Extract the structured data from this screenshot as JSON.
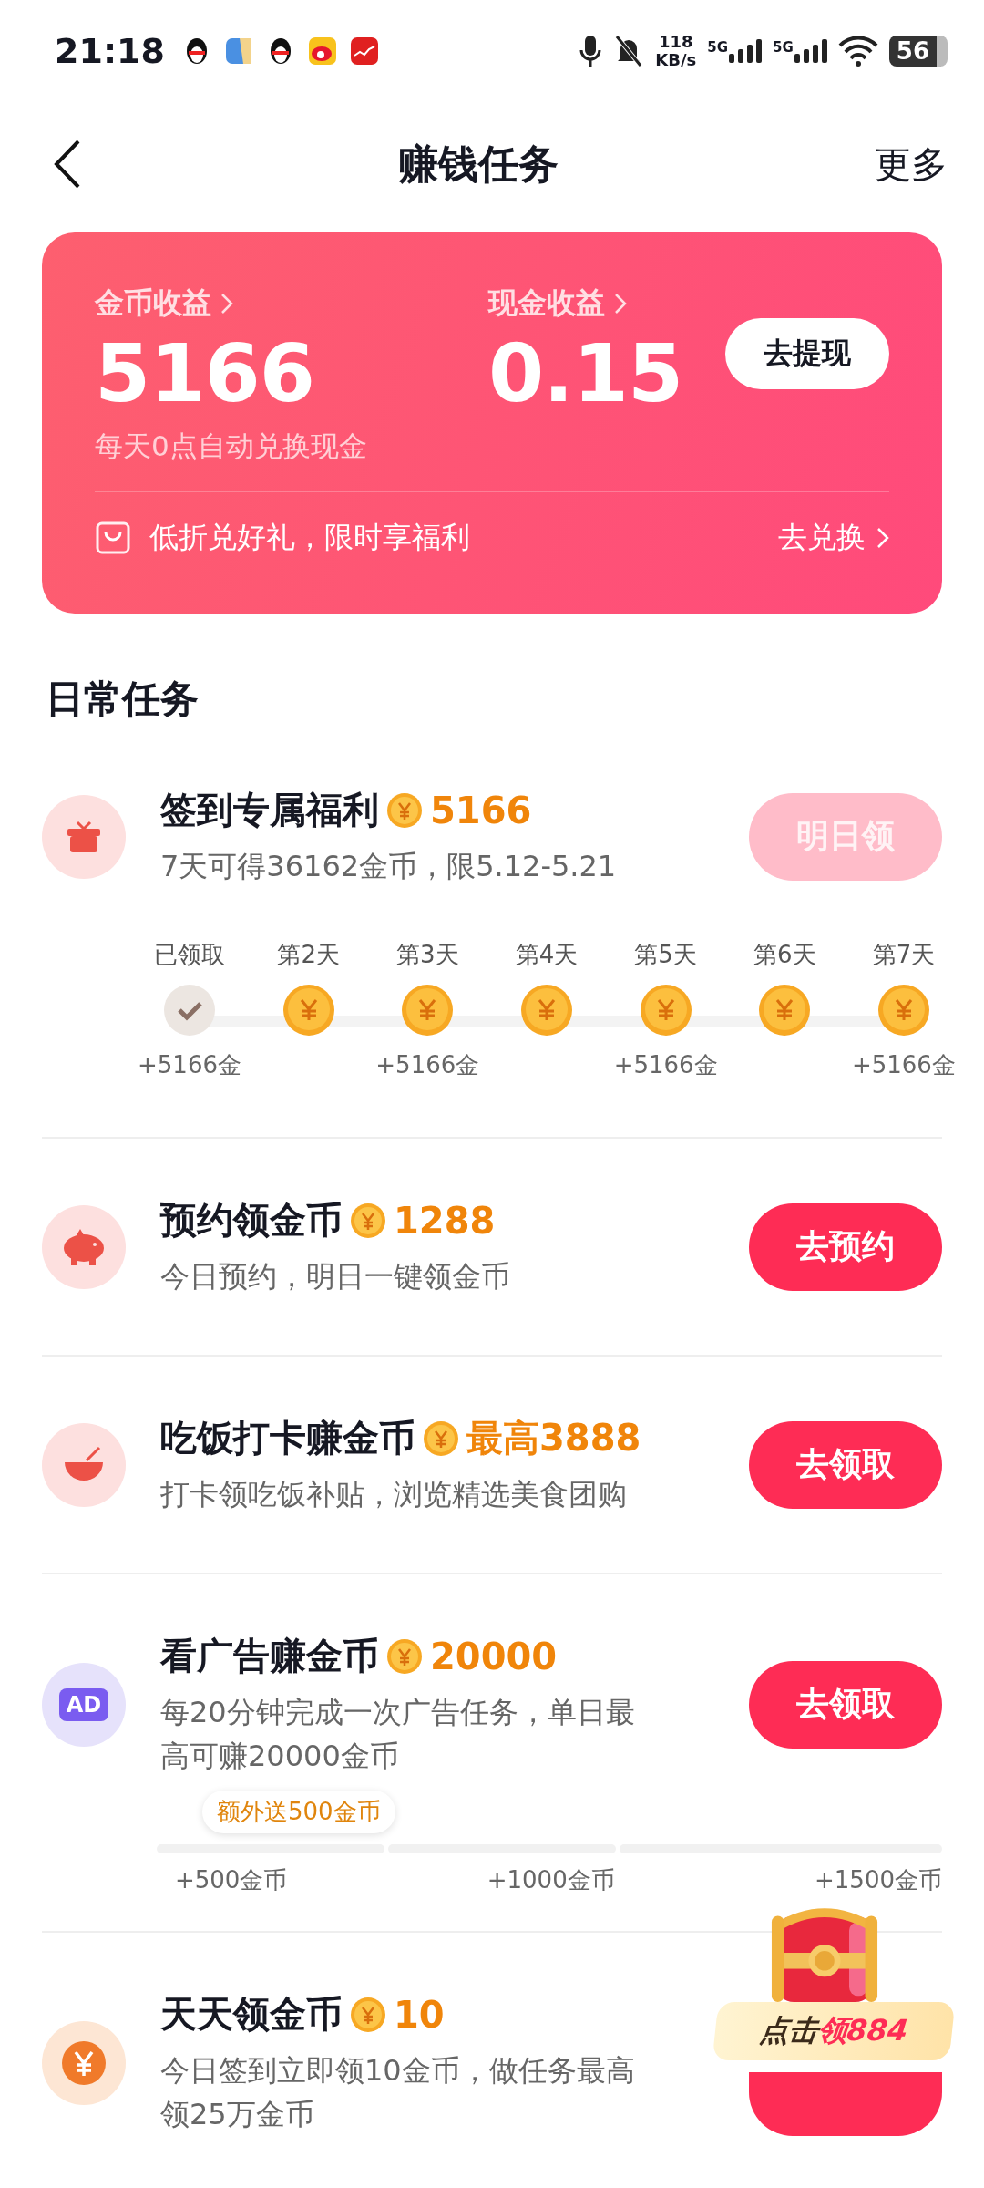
{
  "status_bar": {
    "time": "21:18",
    "net_speed_value": "118",
    "net_speed_unit": "KB/s",
    "sim1": "5G",
    "sim2": "5G",
    "battery": "56"
  },
  "nav": {
    "title": "赚钱任务",
    "more": "更多"
  },
  "earnings": {
    "coin_label": "金币收益",
    "coin_value": "5166",
    "cash_label": "现金收益",
    "cash_value": "0.15",
    "withdraw": "去提现",
    "note": "每天0点自动兑换现金",
    "promo": "低折兑好礼，限时享福利",
    "promo_link": "去兑换"
  },
  "section_title": "日常任务",
  "tasks": [
    {
      "kind": "checkin",
      "title": "签到专属福利",
      "reward": "5166",
      "desc": "7天可得36162金币，限5.12-5.21",
      "button": "明日领",
      "disabled": true,
      "steps": [
        {
          "label": "已领取",
          "claimed": true,
          "bonus": "+5166金"
        },
        {
          "label": "第2天",
          "claimed": false
        },
        {
          "label": "第3天",
          "claimed": false,
          "bonus": "+5166金"
        },
        {
          "label": "第4天",
          "claimed": false
        },
        {
          "label": "第5天",
          "claimed": false,
          "bonus": "+5166金"
        },
        {
          "label": "第6天",
          "claimed": false
        },
        {
          "label": "第7天",
          "claimed": false,
          "bonus": "+5166金"
        }
      ]
    },
    {
      "kind": "plain",
      "title": "预约领金币",
      "reward": "1288",
      "desc": "今日预约，明日一键领金币",
      "button": "去预约",
      "disabled": false
    },
    {
      "kind": "plain",
      "title": "吃饭打卡赚金币",
      "reward": "最高3888",
      "desc": "打卡领吃饭补贴，浏览精选美食团购",
      "button": "去领取",
      "disabled": false
    },
    {
      "kind": "ad",
      "icon_text": "AD",
      "title": "看广告赚金币",
      "reward": "20000",
      "desc": "每20分钟完成一次广告任务，单日最高可赚20000金币",
      "button": "去领取",
      "disabled": false,
      "tooltip": "额外送500金币",
      "milestones": [
        "+500金币",
        "+1000金币",
        "+1500金币"
      ]
    },
    {
      "kind": "plain",
      "title": "天天领金币",
      "reward": "10",
      "desc": "今日签到立即领10金币，做任务最高领25万金币",
      "disabled": false
    }
  ],
  "floating_reward": {
    "prefix": "点击",
    "highlight": "领884"
  }
}
